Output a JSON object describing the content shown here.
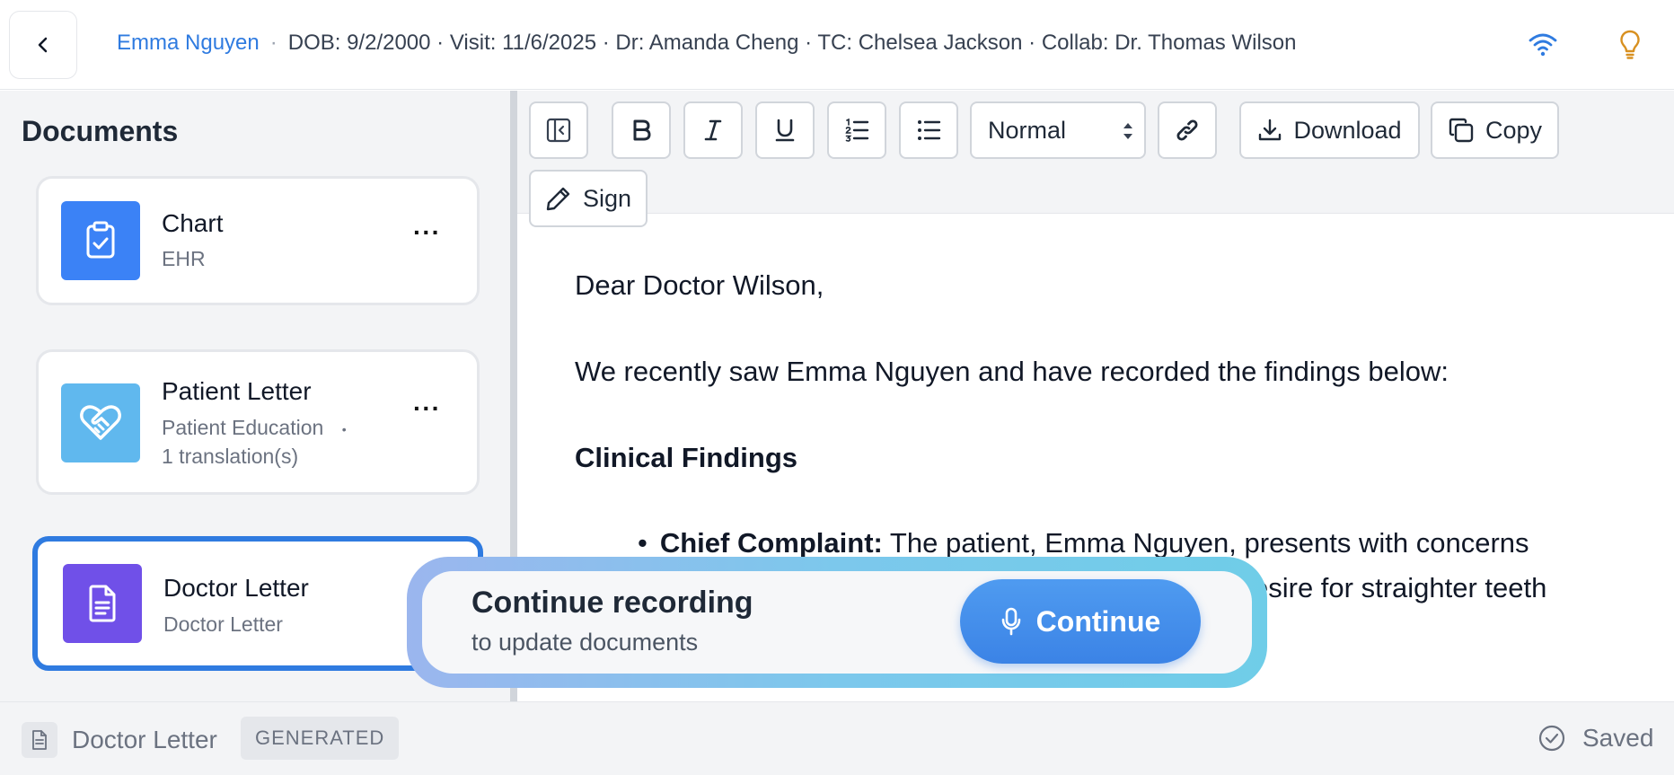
{
  "header": {
    "patient_name": "Emma Nguyen",
    "separator": "·",
    "details": "DOB: 9/2/2000 · Visit: 11/6/2025 · Dr: Amanda Cheng · TC: Chelsea Jackson · Collab: Dr. Thomas Wilson",
    "icons": [
      "back-icon",
      "wifi-icon",
      "lightbulb-icon"
    ]
  },
  "sidebar": {
    "title": "Documents",
    "documents": [
      {
        "name": "Chart",
        "subtitle": "EHR",
        "icon": "clipboard-check-icon",
        "color": "#3b82f6"
      },
      {
        "name": "Patient Letter",
        "subtitle": "Patient Education",
        "subtitle_dot": "•",
        "subtitle2": "1 translation(s)",
        "icon": "heart-handshake-icon",
        "color": "#60b8ee"
      },
      {
        "name": "Doctor Letter",
        "subtitle": "Doctor Letter",
        "icon": "file-text-icon",
        "color": "#7050e8",
        "active": true
      }
    ],
    "more_label": "···"
  },
  "toolbar": {
    "heading_select": "Normal",
    "download_label": "Download",
    "copy_label": "Copy",
    "sign_label": "Sign"
  },
  "document": {
    "greeting": "Dear Doctor Wilson,",
    "intro": "We recently saw Emma Nguyen and have recorded the findings below:",
    "section_heading": "Clinical Findings",
    "bullet_label": "Chief Complaint:",
    "bullet_text_1": "The patient, Emma Nguyen, presents with concerns",
    "bullet_text_2": "esire for straighter teeth"
  },
  "recording_prompt": {
    "title": "Continue recording",
    "subtitle": "to update documents",
    "button_label": "Continue"
  },
  "footer": {
    "document_name": "Doctor Letter",
    "status_badge": "GENERATED",
    "saved_label": "Saved"
  },
  "colors": {
    "accent": "#2f7be0",
    "chart_icon_bg": "#3b82f6",
    "patient_letter_icon_bg": "#60b8ee",
    "doctor_letter_icon_bg": "#7050e8",
    "lightbulb": "#d89020"
  }
}
